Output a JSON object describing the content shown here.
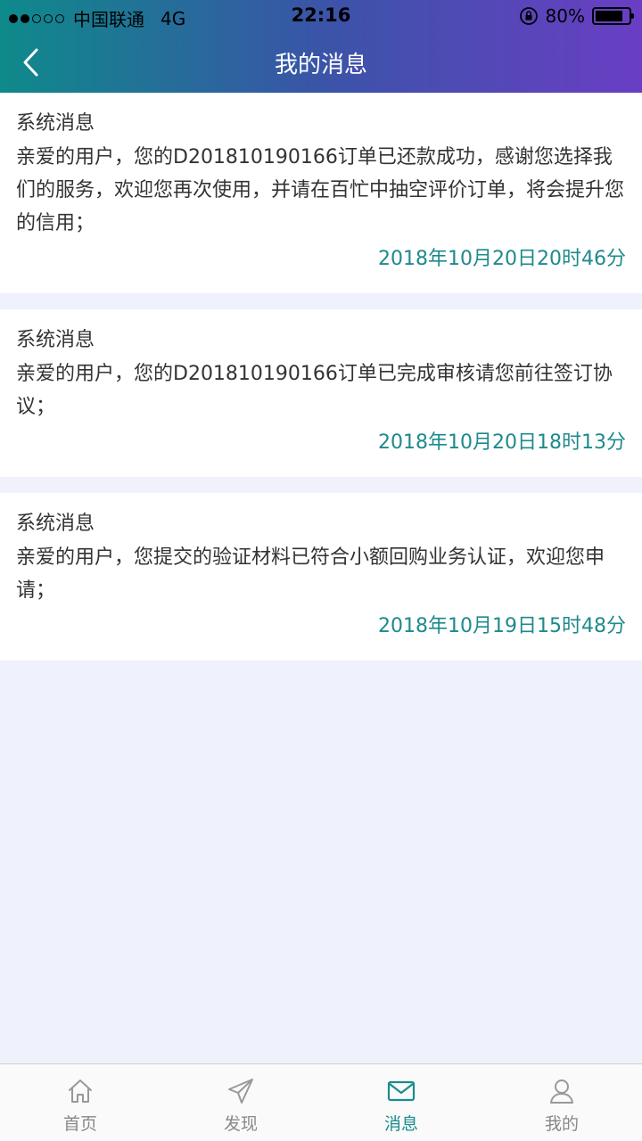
{
  "statusbar": {
    "carrier": "中国联通",
    "network": "4G",
    "time": "22:16",
    "battery": "80%"
  },
  "header": {
    "title": "我的消息"
  },
  "messages": [
    {
      "title": "系统消息",
      "body": "亲爱的用户，您的D201810190166订单已还款成功，感谢您选择我们的服务，欢迎您再次使用，并请在百忙中抽空评价订单，将会提升您的信用；",
      "time": "2018年10月20日20时46分"
    },
    {
      "title": "系统消息",
      "body": "亲爱的用户，您的D201810190166订单已完成审核请您前往签订协议；",
      "time": "2018年10月20日18时13分"
    },
    {
      "title": "系统消息",
      "body": "亲爱的用户，您提交的验证材料已符合小额回购业务认证，欢迎您申请；",
      "time": "2018年10月19日15时48分"
    }
  ],
  "tabbar": {
    "items": [
      {
        "label": "首页",
        "icon": "home-icon"
      },
      {
        "label": "发现",
        "icon": "paper-plane-icon"
      },
      {
        "label": "消息",
        "icon": "mail-icon"
      },
      {
        "label": "我的",
        "icon": "user-icon"
      }
    ],
    "active": 2
  },
  "colors": {
    "accent": "#1a8c8c",
    "header_start": "#0e8a8a",
    "header_end": "#6a3ec4",
    "background": "#eff1fd"
  }
}
